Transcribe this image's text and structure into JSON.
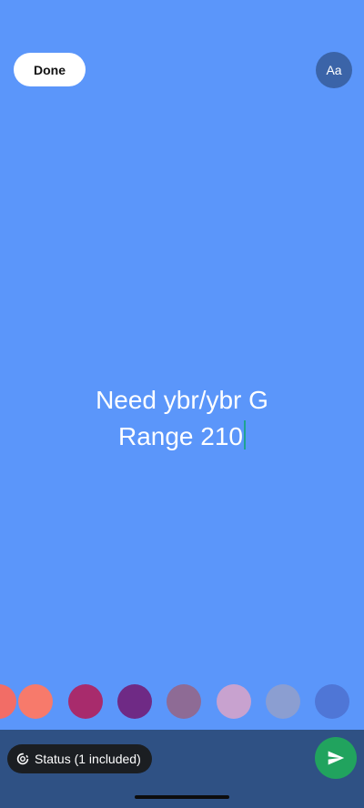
{
  "header": {
    "done_label": "Done",
    "font_button_label": "Aa"
  },
  "status_text": {
    "lines": [
      "Need ybr/ybr G",
      "Range 210"
    ]
  },
  "palette": {
    "colors": [
      "#f26d66",
      "#f77a6b",
      "#a82b6c",
      "#6f2a85",
      "#8e6b95",
      "#c8a2cf",
      "#8b9ed1",
      "#4f76d6"
    ]
  },
  "footer": {
    "audience_label": "Status (1 included)",
    "send_icon": "send-icon"
  },
  "colors": {
    "background": "#5b96fa",
    "bottom_bar": "#2f5184",
    "send_button": "#21a35e",
    "caret": "#1fa392"
  }
}
